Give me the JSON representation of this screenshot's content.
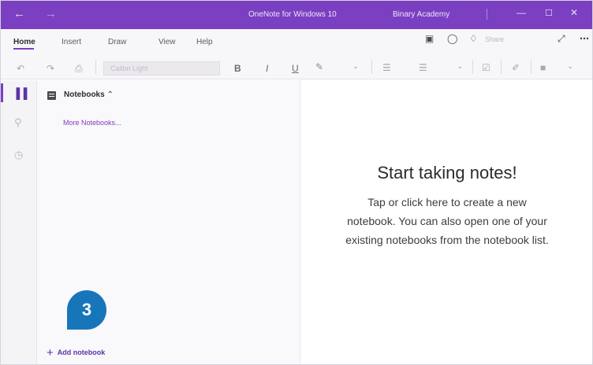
{
  "titlebar": {
    "back_icon": "arrow-left-icon",
    "forward_icon": "arrow-right-icon",
    "app_title": "OneNote for Windows 10",
    "account": "Binary Academy",
    "minimize_icon": "minimize-icon",
    "maximize_icon": "maximize-icon",
    "close_icon": "close-icon"
  },
  "menu": {
    "items": [
      "Home",
      "Insert",
      "Draw",
      "View",
      "Help"
    ],
    "active": "Home",
    "share_label": "Share"
  },
  "toolbar": {
    "font_name": "Calibri Light",
    "bold": "B",
    "italic": "I",
    "underline": "U"
  },
  "notebooks": {
    "header": "Notebooks",
    "more_link": "More Notebooks...",
    "add_label": "Add notebook"
  },
  "callout": {
    "number": "3",
    "color": "#1776ba"
  },
  "main": {
    "title": "Start taking notes!",
    "lines": [
      "Tap or click here to create a new",
      "notebook. You can also open one of your",
      "existing notebooks from the notebook list."
    ]
  },
  "colors": {
    "accent": "#7b3fc2"
  }
}
